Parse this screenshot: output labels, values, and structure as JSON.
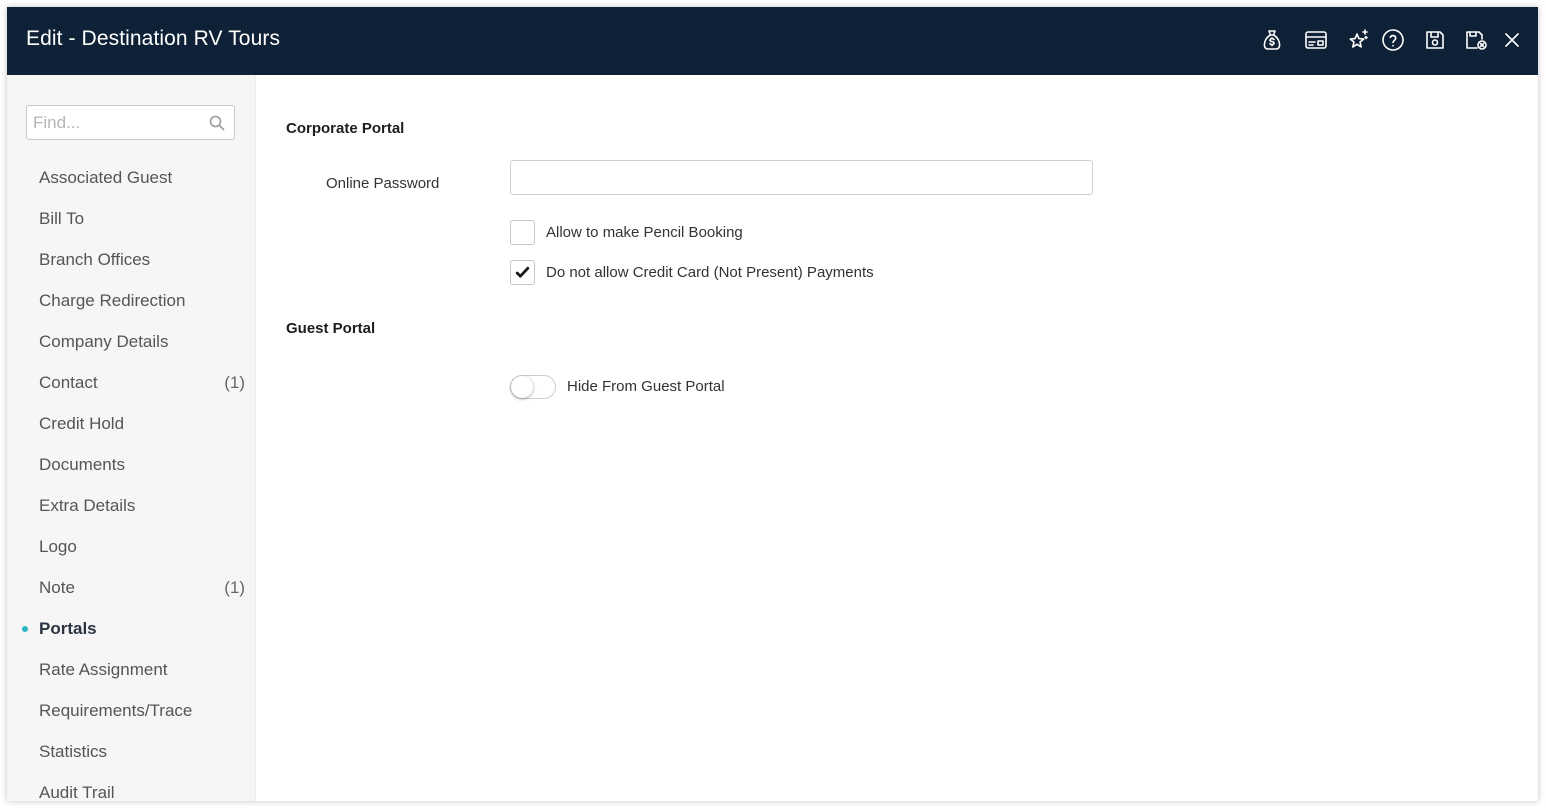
{
  "window": {
    "title": "Edit - Destination RV Tours"
  },
  "toolbar": {
    "icons": [
      "money-bag-icon",
      "id-card-icon",
      "sparkle-star-icon",
      "help-icon",
      "save-icon",
      "save-close-icon",
      "close-icon"
    ]
  },
  "sidebar": {
    "search_placeholder": "Find...",
    "items": [
      {
        "label": "Associated Guest",
        "count": ""
      },
      {
        "label": "Bill To",
        "count": ""
      },
      {
        "label": "Branch Offices",
        "count": ""
      },
      {
        "label": "Charge Redirection",
        "count": ""
      },
      {
        "label": "Company Details",
        "count": ""
      },
      {
        "label": "Contact",
        "count": "(1)"
      },
      {
        "label": "Credit Hold",
        "count": ""
      },
      {
        "label": "Documents",
        "count": ""
      },
      {
        "label": "Extra Details",
        "count": ""
      },
      {
        "label": "Logo",
        "count": ""
      },
      {
        "label": "Note",
        "count": "(1)"
      },
      {
        "label": "Portals",
        "count": "",
        "active": true
      },
      {
        "label": "Rate Assignment",
        "count": ""
      },
      {
        "label": "Requirements/Trace",
        "count": ""
      },
      {
        "label": "Statistics",
        "count": ""
      },
      {
        "label": "Audit Trail",
        "count": ""
      }
    ]
  },
  "corporate_portal": {
    "title": "Corporate Portal",
    "password_label": "Online Password",
    "password_value": "",
    "pencil_booking_label": "Allow to make Pencil Booking",
    "pencil_booking_checked": false,
    "no_cnp_label": "Do not allow Credit Card (Not Present) Payments",
    "no_cnp_checked": true
  },
  "guest_portal": {
    "title": "Guest Portal",
    "hide_label": "Hide From Guest Portal",
    "hide_on": false
  },
  "colors": {
    "titlebar": "#0e2136",
    "accent_dot": "#2bb4c4",
    "sidebar_bg": "#f6f6f6"
  }
}
